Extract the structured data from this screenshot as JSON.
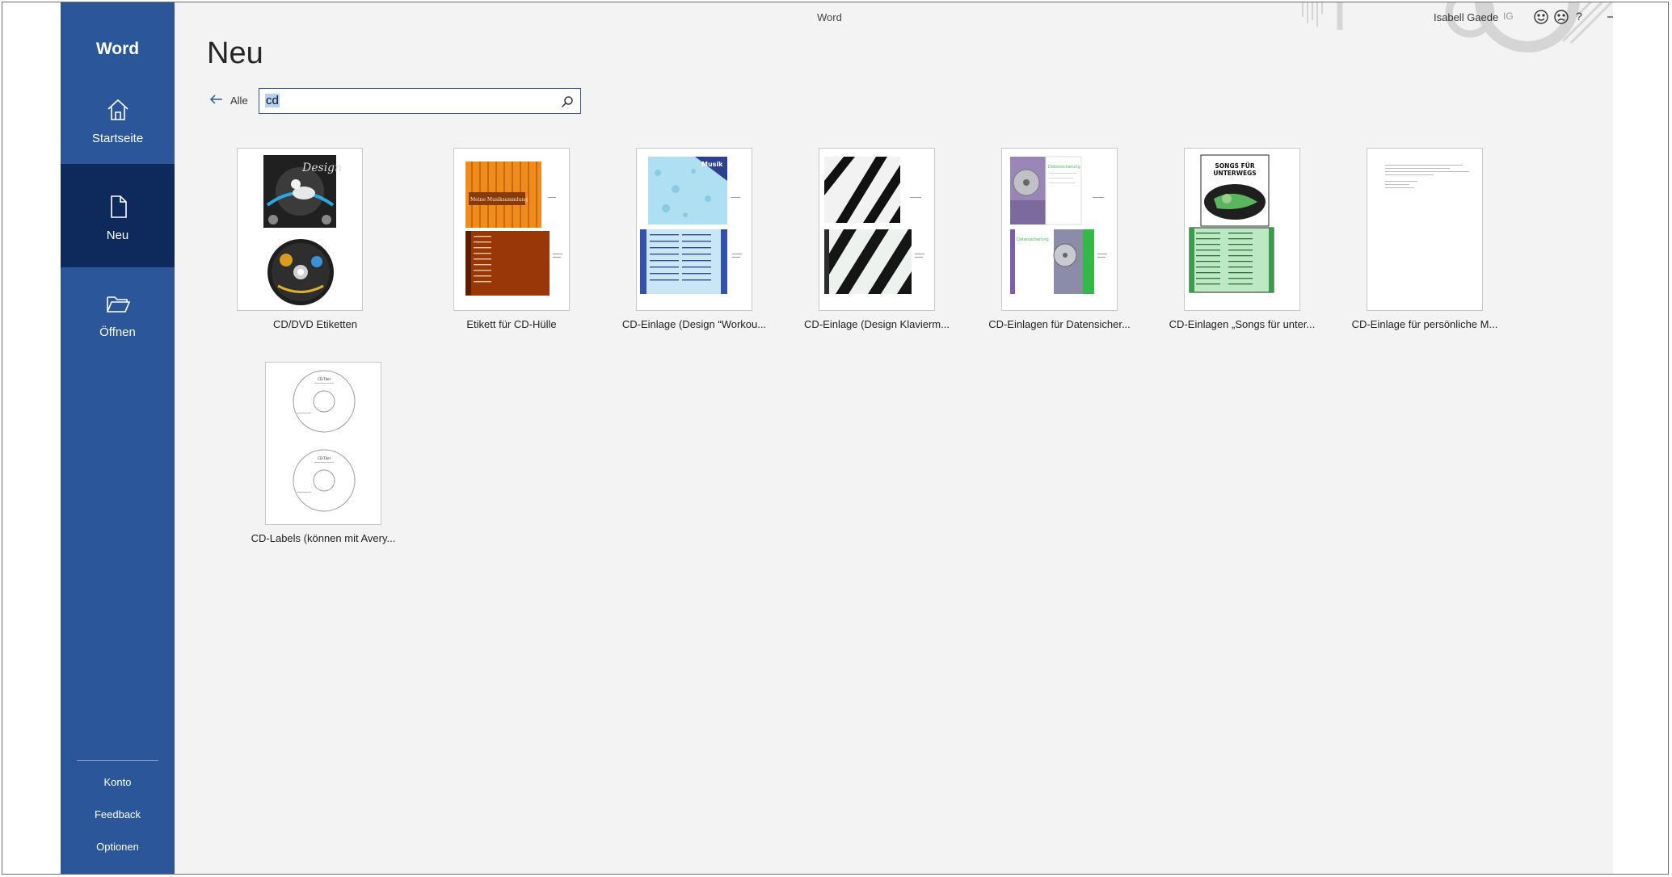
{
  "window": {
    "title": "Word"
  },
  "sidebar": {
    "app_name": "Word",
    "nav": [
      {
        "label": "Startseite",
        "icon": "home-icon"
      },
      {
        "label": "Neu",
        "icon": "new-document-icon",
        "active": true
      },
      {
        "label": "Öffnen",
        "icon": "folder-open-icon"
      }
    ],
    "bottom": [
      "Konto",
      "Feedback",
      "Optionen"
    ]
  },
  "titlebar": {
    "user_name": "Isabell Gaede",
    "user_initials": "IG",
    "help": "?",
    "icons": [
      "smile-icon",
      "frown-icon",
      "minimize-icon",
      "restore-icon",
      "close-icon"
    ]
  },
  "main": {
    "heading": "Neu",
    "back_label": "Alle",
    "search_value": "cd",
    "templates": [
      {
        "label": "CD/DVD Etiketten"
      },
      {
        "label": "Etikett für CD-Hülle"
      },
      {
        "label": "CD-Einlage (Design “Workou..."
      },
      {
        "label": "CD-Einlage (Design Klavierm..."
      },
      {
        "label": "CD-Einlagen für Datensicher..."
      },
      {
        "label": "CD-Einlagen „Songs für unter..."
      },
      {
        "label": "CD-Einlage für persönliche M..."
      },
      {
        "label": "CD-Labels (können mit Avery..."
      }
    ]
  },
  "thumb_text": {
    "design": "Design",
    "musik": "Musik",
    "sammlung": "Meine Musiksammlung",
    "songs": "SONGS FÜR UNTERWEGS",
    "daten": "Datensicherung",
    "cd_title": "CD-Titel"
  },
  "colors": {
    "sidebar": "#2b579a",
    "sidebar_active": "#0e2a5c",
    "background": "#f3f3f3",
    "accent": "#2b579a"
  }
}
